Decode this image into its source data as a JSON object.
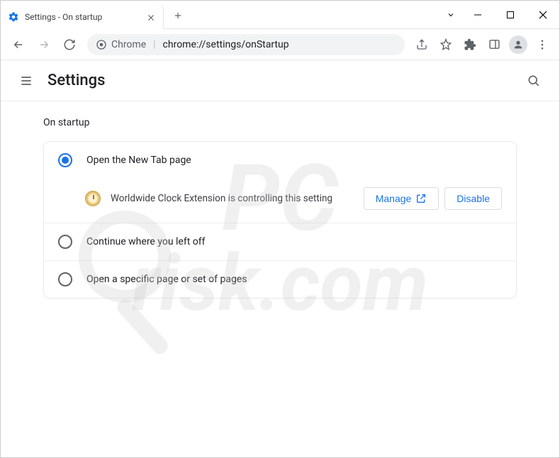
{
  "tab": {
    "title": "Settings - On startup"
  },
  "omnibox": {
    "host": "Chrome",
    "rest": "chrome://settings/onStartup"
  },
  "header": {
    "title": "Settings"
  },
  "section": {
    "title": "On startup"
  },
  "options": {
    "open_new_tab": "Open the New Tab page",
    "continue": "Continue where you left off",
    "specific": "Open a specific page or set of pages"
  },
  "extension_notice": {
    "message": "Worldwide Clock Extension is controlling this setting",
    "manage": "Manage",
    "disable": "Disable"
  },
  "watermark": {
    "line1": "PC",
    "line2": "risk.com"
  }
}
